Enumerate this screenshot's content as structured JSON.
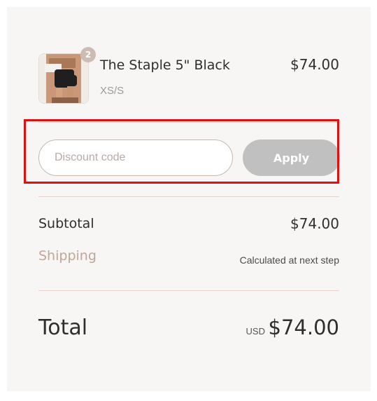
{
  "cart_item": {
    "quantity": "2",
    "name": "The Staple 5\" Black",
    "variant": "XS/S",
    "price": "$74.00"
  },
  "discount": {
    "placeholder": "Discount code",
    "value": "",
    "apply_label": "Apply"
  },
  "summary": {
    "subtotal_label": "Subtotal",
    "subtotal_value": "$74.00",
    "shipping_label": "Shipping",
    "shipping_value": "Calculated at next step",
    "total_label": "Total",
    "total_currency": "USD",
    "total_value": "$74.00"
  },
  "colors": {
    "panel_bg": "#f8f6f4",
    "divider": "#e6d2c8",
    "apply_disabled": "#c0c0c0",
    "shipping_accent": "#c1a595",
    "highlight": "#e01010"
  }
}
